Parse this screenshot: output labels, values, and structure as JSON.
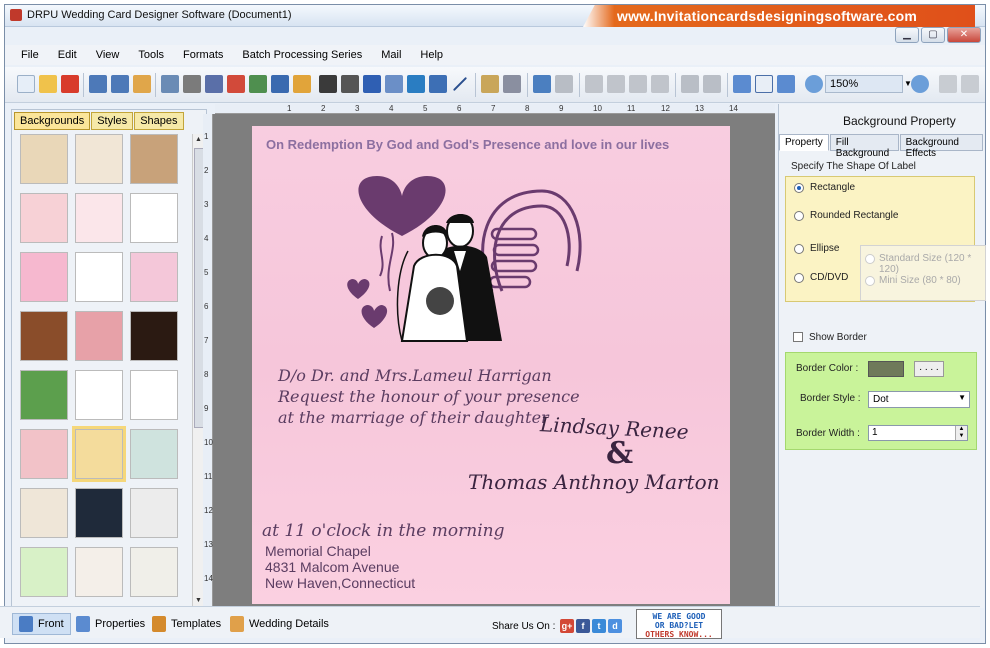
{
  "window": {
    "title": "DRPU Wedding Card Designer Software (Document1)",
    "banner": "www.Invitationcardsdesigningsoftware.com"
  },
  "menu": [
    "File",
    "Edit",
    "View",
    "Tools",
    "Formats",
    "Batch Processing Series",
    "Mail",
    "Help"
  ],
  "toolbar": {
    "zoom": "150%"
  },
  "left_panel": {
    "tabs": [
      "Backgrounds",
      "Styles",
      "Shapes"
    ],
    "active_tab": "Backgrounds",
    "selected_thumbnail_index": 16
  },
  "ruler": {
    "h_ticks": [
      "1",
      "2",
      "3",
      "4",
      "5",
      "6",
      "7",
      "8",
      "9",
      "10",
      "11",
      "12",
      "13",
      "14"
    ],
    "v_ticks": [
      "1",
      "2",
      "3",
      "4",
      "5",
      "6",
      "7",
      "8",
      "9",
      "10",
      "11",
      "12",
      "13",
      "14"
    ]
  },
  "card": {
    "top_line": "On Redemption By God and God's Presence and love in our lives",
    "parents_line1": "D/o Dr. and Mrs.Lameul Harrigan",
    "parents_line2": "Request the honour of your presence",
    "parents_line3": "at the marriage of their daughter",
    "bride_name": "Lindsay  Renee",
    "ampersand": "&",
    "groom_name": "Thomas  Anthnoy  Marton",
    "time_line": "at 11 o'clock in the morning",
    "venue1": "Memorial Chapel",
    "venue2": "4831 Malcom Avenue",
    "venue3": "New Haven,Connecticut"
  },
  "right_panel": {
    "title": "Background Property",
    "tabs": [
      "Property",
      "Fill Background",
      "Background Effects"
    ],
    "active_tab": "Property",
    "shape_label": "Specify The Shape Of Label",
    "shapes": [
      "Rectangle",
      "Rounded Rectangle",
      "Ellipse",
      "CD/DVD"
    ],
    "selected_shape": "Rectangle",
    "cd_sizes": [
      "Standard Size (120 * 120)",
      "Mini Size (80 * 80)"
    ],
    "show_border_label": "Show Border",
    "show_border": false,
    "border_color_label": "Border Color :",
    "border_color": "#6f7a5a",
    "color_button": ". . . .",
    "border_style_label": "Border Style :",
    "border_style": "Dot",
    "border_width_label": "Border Width :",
    "border_width": "1"
  },
  "bottom": {
    "tabs": [
      "Front",
      "Properties",
      "Templates",
      "Wedding Details"
    ],
    "active_tab": "Front",
    "share_label": "Share Us On :",
    "share_icons": [
      "google-plus",
      "facebook",
      "twitter",
      "delicious"
    ],
    "feedback_text": [
      "WE ARE GOOD",
      "OR BAD?LET",
      "OTHERS KNOW..."
    ]
  }
}
